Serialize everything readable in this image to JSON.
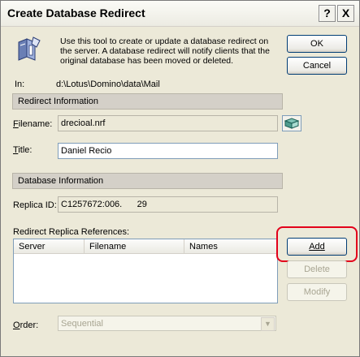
{
  "window": {
    "title": "Create Database Redirect",
    "help_glyph": "?",
    "close_glyph": "X"
  },
  "description": "Use this tool to create or update a database redirect on the server. A database redirect will notify clients that the original database has been moved or deleted.",
  "in": {
    "label": "In:",
    "value": "d:\\Lotus\\Domino\\data\\Mail"
  },
  "buttons": {
    "ok": "OK",
    "cancel": "Cancel",
    "add": "Add",
    "delete": "Delete",
    "modify": "Modify"
  },
  "redirect_section": {
    "header": "Redirect Information",
    "filename_label_accel": "F",
    "filename_label_rest": "ilename:",
    "filename_value": "drecioal.nrf",
    "title_label_accel": "T",
    "title_label_rest": "itle:",
    "title_value": "Daniel Recio"
  },
  "db_section": {
    "header": "Database Information",
    "replica_label": "Replica ID:",
    "replica_value": "C1257672:006.      29"
  },
  "references": {
    "label": "Redirect Replica References:",
    "columns": [
      "Server",
      "Filename",
      "Names"
    ],
    "rows": []
  },
  "order": {
    "label_accel": "O",
    "label_rest": "rder:",
    "selected": "Sequential"
  },
  "colors": {
    "highlight": "#e3001b",
    "dialog_bg": "#ece9d8"
  }
}
